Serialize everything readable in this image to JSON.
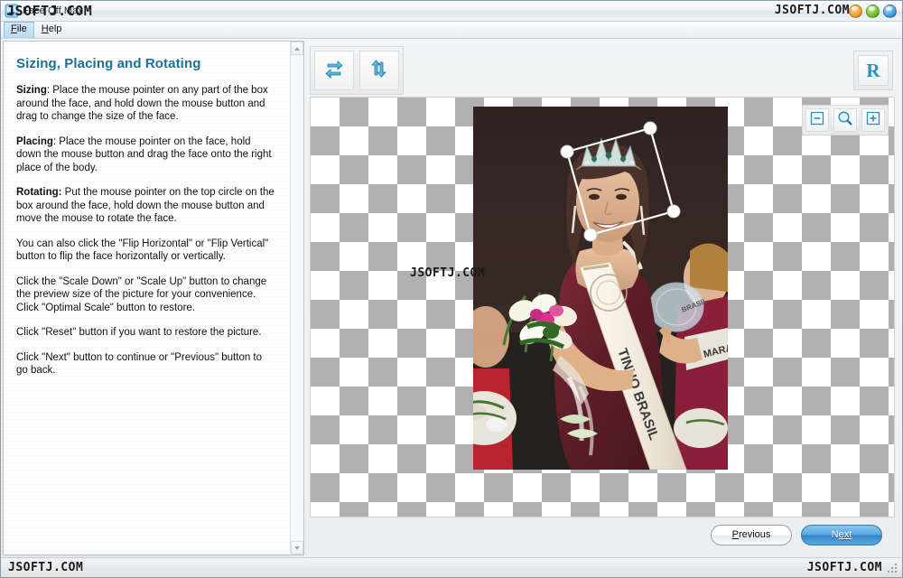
{
  "window": {
    "title": "Face Off Max",
    "icon": "app-icon",
    "controls": [
      {
        "name": "minimize-button",
        "label": "",
        "color": "#f0a030"
      },
      {
        "name": "maximize-button",
        "label": "",
        "color": "#74c032"
      },
      {
        "name": "close-button",
        "label": "",
        "color": "#3f9ede"
      }
    ]
  },
  "watermarks": {
    "title_left": "JSOFTJ.COM",
    "title_right": "JSOFTJ.COM",
    "canvas": "JSOFTJ.COM",
    "status_left": "JSOFTJ.COM",
    "status_right": "JSOFTJ.COM"
  },
  "menu": {
    "items": [
      {
        "label": "File",
        "mnemonic": "F",
        "rest": "ile",
        "active": true
      },
      {
        "label": "Help",
        "mnemonic": "H",
        "rest": "elp",
        "active": false
      }
    ]
  },
  "help": {
    "title": "Sizing, Placing and Rotating",
    "paragraphs": [
      {
        "lead": "Sizing",
        "lead_sep": ": ",
        "text": "Place the mouse pointer on any part of the box around the face, and hold down the mouse button and drag to change the size of the face."
      },
      {
        "lead": "Placing",
        "lead_sep": ": ",
        "text": "Place the mouse pointer on the face, hold down the mouse button and drag the face onto the right place of the body."
      },
      {
        "lead": "Rotating:",
        "lead_sep": " ",
        "text": "Put the mouse pointer on the top circle on the box around the face, hold down the mouse button and move the mouse to rotate the face."
      },
      {
        "lead": "",
        "lead_sep": "",
        "text": "You can also click the \"Flip Horizontal\" or \"Flip Vertical\" button to flip the face horizontally or vertically."
      },
      {
        "lead": "",
        "lead_sep": "",
        "text": "Click the \"Scale Down\" or \"Scale Up\" button to change the preview size of the picture for your convenience. Click \"Optimal Scale\" button to restore."
      },
      {
        "lead": "",
        "lead_sep": "",
        "text": "Click \"Reset\" button if you want to restore the picture."
      },
      {
        "lead": "",
        "lead_sep": "",
        "text": "Click \"Next\" button to continue or \"Previous\" button to go back."
      }
    ],
    "scroll": {
      "up_icon": "scroll-up-arrow-icon",
      "down_icon": "scroll-down-arrow-icon"
    }
  },
  "toolbar": {
    "flip_horizontal": {
      "name": "flip-horizontal-button",
      "tooltip": "Flip Horizontal",
      "icon": "flip-horizontal-icon"
    },
    "flip_vertical": {
      "name": "flip-vertical-button",
      "tooltip": "Flip Vertical",
      "icon": "flip-vertical-icon"
    },
    "reset": {
      "name": "reset-button",
      "label": "R",
      "tooltip": "Reset",
      "icon": "reset-icon"
    }
  },
  "zoom_controls": {
    "scale_down": {
      "label": "−",
      "tooltip": "Scale Down",
      "icon": "minus-icon"
    },
    "optimal_scale": {
      "label": "",
      "tooltip": "Optimal Scale",
      "icon": "magnifier-icon"
    },
    "scale_up": {
      "label": "+",
      "tooltip": "Scale Up",
      "icon": "plus-icon"
    }
  },
  "canvas": {
    "background": "transparency-checkerboard",
    "checker_color": "#b0b0b0",
    "photo_alt": "beauty-pageant-winner-with-tiara-and-flowers",
    "sash_text": "TINHO BRASIL",
    "sash_text_2": "MARANHAO",
    "selection": {
      "name": "face-selection-box",
      "handles": [
        "rotate-handle-top",
        "handle-top-left",
        "handle-top-right",
        "handle-bottom-left",
        "handle-bottom-right"
      ],
      "color": "#ffffff"
    }
  },
  "footer": {
    "previous": {
      "label": "Previous",
      "mnemonic": "P",
      "rest": "revious"
    },
    "next": {
      "label": "Next",
      "mnemonic": "N",
      "pre": "N",
      "rest": "ext"
    }
  },
  "colors": {
    "accent": "#1f6f96",
    "next_button": "#2f86c9",
    "checker": "#b0b0b0"
  }
}
